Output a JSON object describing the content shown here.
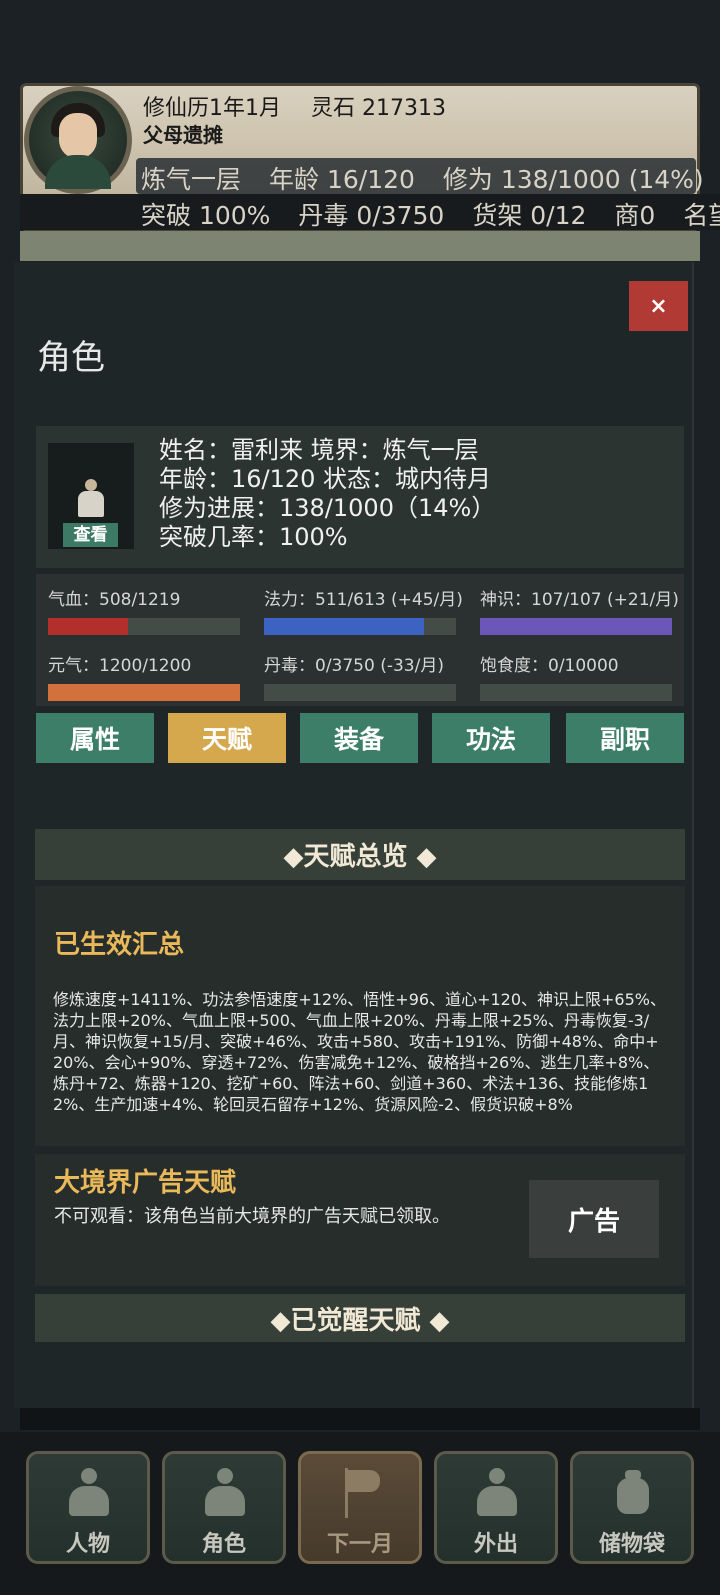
{
  "hud": {
    "calendar": "修仙历1年1月",
    "spirit_stones": "灵石 217313",
    "subtitle": "父母遗摊",
    "row1": [
      "炼气一层",
      "年龄 16/120",
      "修为 138/1000 (14%)"
    ],
    "row2": [
      "突破 100%",
      "丹毒 0/3750",
      "货架 0/12",
      "商0",
      "名望"
    ]
  },
  "modal": {
    "title": "角色",
    "close_label": "×",
    "view_label": "查看",
    "info": {
      "line1": "姓名：雷利来    境界：炼气一层",
      "line2": "年龄：16/120    状态：城内待月",
      "line3": "修为进展：138/1000（14%）",
      "line4": "突破几率：100%"
    },
    "stats": [
      {
        "label": "气血：508/1219",
        "fraction": 0.417,
        "color": "#b32f2b"
      },
      {
        "label": "法力：511/613 (+45/月)",
        "fraction": 0.834,
        "color": "#3c63c2"
      },
      {
        "label": "神识：107/107 (+21/月)",
        "fraction": 1.0,
        "color": "#6b57b8"
      },
      {
        "label": "元气：1200/1200",
        "fraction": 1.0,
        "color": "#d3713e"
      },
      {
        "label": "丹毒：0/3750 (-33/月)",
        "fraction": 0.0,
        "color": "#888888"
      },
      {
        "label": "饱食度：0/10000",
        "fraction": 0.0,
        "color": "#888888"
      }
    ],
    "tabs": [
      "属性",
      "天赋",
      "装备",
      "功法",
      "副职"
    ],
    "active_tab": "天赋",
    "talent_overview": "◆天赋总览 ◆",
    "summary_title": "已生效汇总",
    "summary_text": "修炼速度+1411%、功法参悟速度+12%、悟性+96、道心+120、神识上限+65%、法力上限+20%、气血上限+500、气血上限+20%、丹毒上限+25%、丹毒恢复-3/月、神识恢复+15/月、突破+46%、攻击+580、攻击+191%、防御+48%、命中+20%、会心+90%、穿透+72%、伤害减免+12%、破格挡+26%、逃生几率+8%、炼丹+72、炼器+120、挖矿+60、阵法+60、剑道+360、术法+136、技能修炼12%、生产加速+4%、轮回灵石留存+12%、货源风险-2、假货识破+8%",
    "ad_title": "大境界广告天赋",
    "ad_desc": "不可观看：该角色当前大境界的广告天赋已领取。",
    "ad_button": "广告",
    "awakened": "◆已觉醒天赋 ◆"
  },
  "nav": [
    "人物",
    "角色",
    "下一月",
    "外出",
    "储物袋"
  ]
}
